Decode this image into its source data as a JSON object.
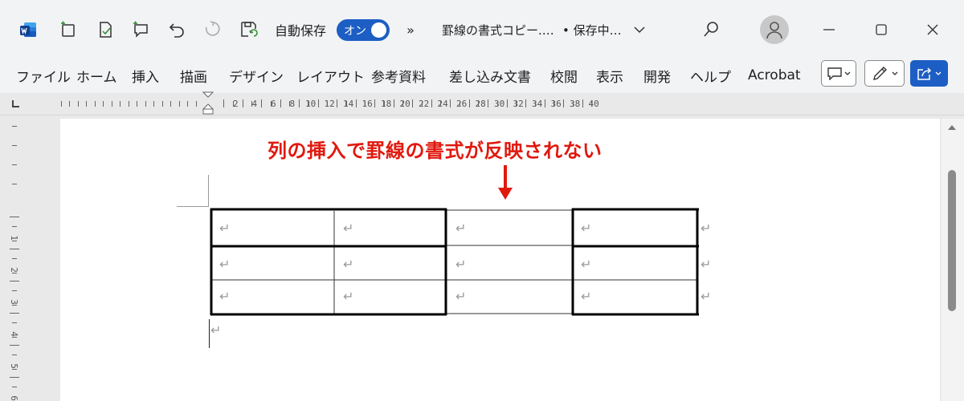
{
  "titlebar": {
    "autosave_label": "自動保存",
    "autosave_toggle": "オン",
    "more": "»",
    "doc_title": "罫線の書式コピー.…",
    "save_status": "• 保存中…"
  },
  "ribbon_tabs": [
    "ファイル",
    "ホーム",
    "挿入",
    "描画",
    "デザイン",
    "レイアウト",
    "参考資料",
    "差し込み文書",
    "校閲",
    "表示",
    "開発",
    "ヘルプ",
    "Acrobat"
  ],
  "ruler": {
    "labels": [
      "2",
      "4",
      "6",
      "8",
      "10",
      "12",
      "14",
      "16",
      "18",
      "20",
      "22",
      "24",
      "26",
      "28",
      "30",
      "32",
      "34",
      "36",
      "38",
      "40"
    ],
    "vertical_labels": [
      "1",
      "2",
      "3",
      "4",
      "5",
      "6"
    ]
  },
  "document": {
    "annotation": "列の挿入で罫線の書式が反映されない",
    "cell_mark": "↵",
    "rows": 3,
    "cols": 4
  },
  "colors": {
    "accent": "#1c5ec4",
    "annotation": "#e0190f"
  },
  "icons": [
    "word-icon",
    "new-doc-icon",
    "edit-doc-icon",
    "comment-icon",
    "undo-icon",
    "redo-icon",
    "save-refresh-icon",
    "search-icon",
    "avatar-icon",
    "minimize-icon",
    "maximize-icon",
    "close-icon",
    "comment-button-icon",
    "pen-icon",
    "share-icon"
  ]
}
